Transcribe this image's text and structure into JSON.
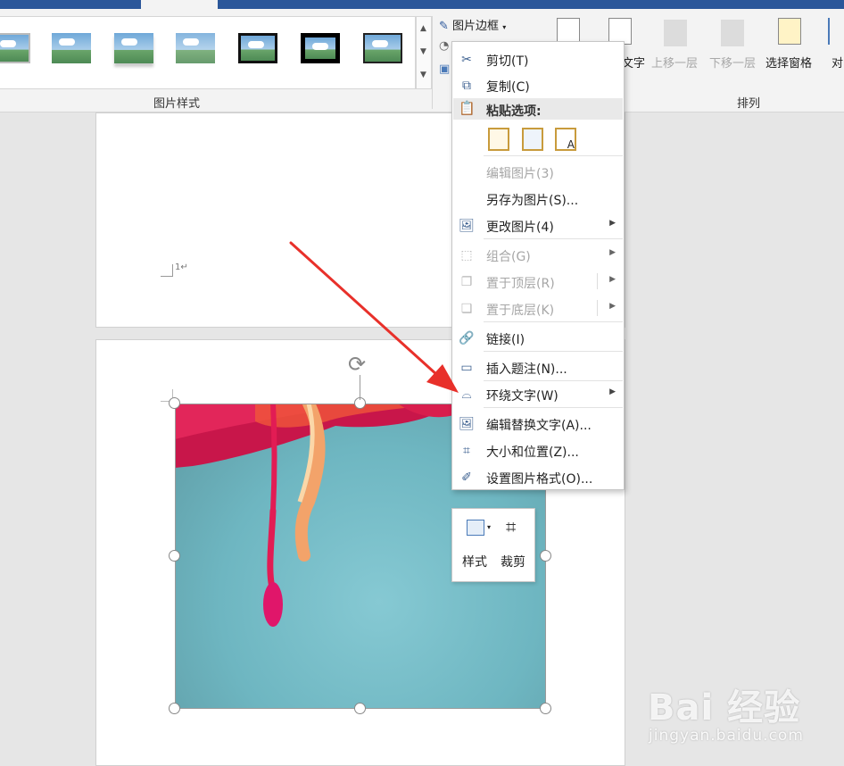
{
  "ribbon": {
    "picture_styles_label": "图片样式",
    "arrange_label": "排列",
    "picture_border": "图片边框",
    "wrap_text_partial": "文字",
    "bring_forward": "上移一层",
    "send_backward": "下移一层",
    "selection_pane": "选择窗格",
    "align_partial": "对"
  },
  "document": {
    "paragraph_mark": "1↵"
  },
  "context_menu": {
    "cut": "剪切(T)",
    "copy": "复制(C)",
    "paste_options": "粘贴选项:",
    "edit_picture": "编辑图片(3)",
    "save_as_picture": "另存为图片(S)...",
    "change_picture": "更改图片(4)",
    "group": "组合(G)",
    "bring_to_front": "置于顶层(R)",
    "send_to_back": "置于底层(K)",
    "link": "链接(I)",
    "insert_caption": "插入题注(N)...",
    "wrap_text": "环绕文字(W)",
    "edit_alt_text": "编辑替换文字(A)...",
    "size_position": "大小和位置(Z)...",
    "format_picture": "设置图片格式(O)..."
  },
  "mini_toolbar": {
    "style": "样式",
    "crop": "裁剪"
  },
  "watermark": {
    "main": "Bai 经验",
    "sub": "jingyan.baidu.com"
  },
  "colors": {
    "ribbon_blue": "#2b579a",
    "arrow_red": "#e8302a"
  }
}
